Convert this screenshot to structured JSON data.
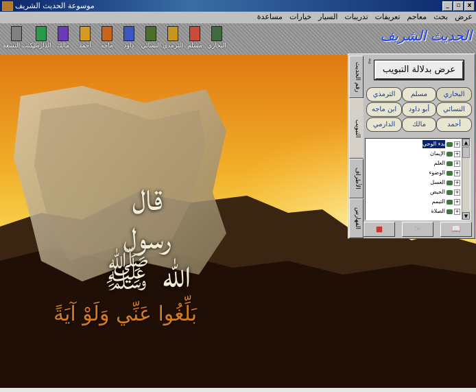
{
  "window": {
    "title": "موسوعة الحديث الشريف",
    "buttons": [
      "_",
      "▫",
      "x"
    ]
  },
  "menu": [
    "عرض",
    "بحث",
    "معاجم",
    "تعريفات",
    "تدريبات",
    "السيار",
    "خيارات",
    "مساعدة"
  ],
  "toolbar": [
    {
      "label": "البخاري",
      "color": "#3f6b3f"
    },
    {
      "label": "مسلم",
      "color": "#c94b3a"
    },
    {
      "label": "الترمذي",
      "color": "#c89520"
    },
    {
      "label": "النسائي",
      "color": "#4b6e2b"
    },
    {
      "label": "داود",
      "color": "#3a56c0"
    },
    {
      "label": "ماجه",
      "color": "#c9641a"
    },
    {
      "label": "أحمد",
      "color": "#d49a22"
    },
    {
      "label": "مالك",
      "color": "#6b3ab8"
    },
    {
      "label": "الدارمي",
      "color": "#2a9a4a"
    },
    {
      "label": "الكتب التسعة",
      "color": "#808080"
    }
  ],
  "logo": "الحديث الشريف",
  "scene": {
    "calligraphy": "قال رسول الله ﷺ",
    "slogan": "بَلِّغُوا عَنِّي وَلَوْ آيَةً"
  },
  "panel": {
    "tabs": [
      "رقم الحديث",
      "التبويب",
      "الأطراف",
      "الفهارس"
    ],
    "active_tab": "التبويب",
    "search_button": "عرض بدلالة التبويب",
    "books": [
      {
        "label": "البخاري",
        "selected": true
      },
      {
        "label": "مسلم",
        "selected": false
      },
      {
        "label": "الترمذي",
        "selected": false
      },
      {
        "label": "النسائي",
        "selected": false
      },
      {
        "label": "أبو داود",
        "selected": false
      },
      {
        "label": "ابن ماجه",
        "selected": false
      },
      {
        "label": "أحمد",
        "selected": false
      },
      {
        "label": "مالك",
        "selected": false
      },
      {
        "label": "الدارمي",
        "selected": false
      }
    ],
    "tree": [
      {
        "label": "بدء الوحي",
        "selected": true
      },
      {
        "label": "الإيمان",
        "selected": false
      },
      {
        "label": "العلم",
        "selected": false
      },
      {
        "label": "الوضوء",
        "selected": false
      },
      {
        "label": "الغسل",
        "selected": false
      },
      {
        "label": "الحيض",
        "selected": false
      },
      {
        "label": "التيمم",
        "selected": false
      },
      {
        "label": "الصلاة",
        "selected": false
      }
    ],
    "bottom_buttons": [
      "📖",
      "☞",
      "■"
    ]
  }
}
